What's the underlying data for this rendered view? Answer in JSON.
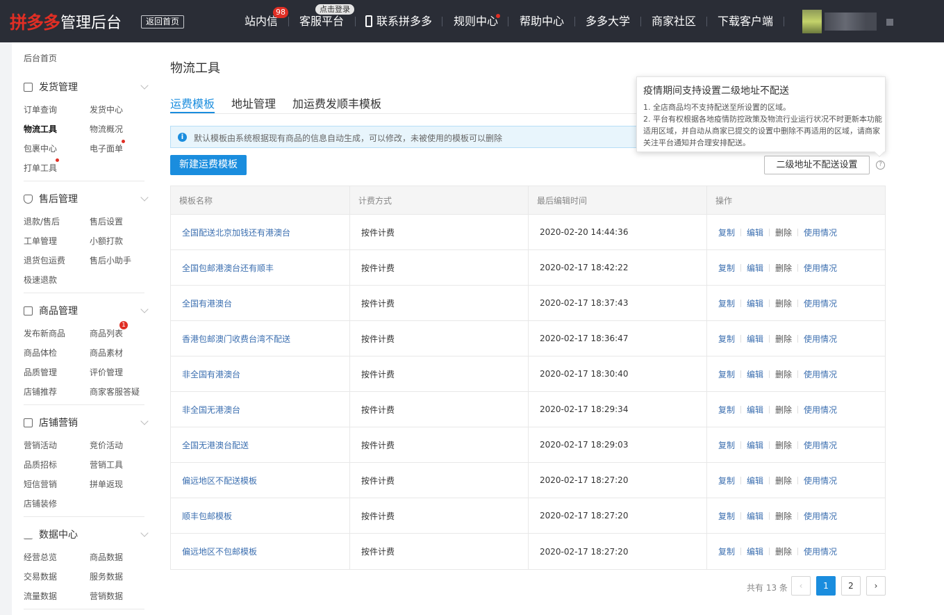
{
  "topbar": {
    "brand": "拼多多",
    "title": "管理后台",
    "back_home": "返回首页",
    "nav": {
      "messages": "站内信",
      "messages_badge": "98",
      "service": "客服平台",
      "service_tip": "点击登录",
      "contact": "联系拼多多",
      "rules": "规则中心",
      "help": "帮助中心",
      "university": "多多大学",
      "community": "商家社区",
      "download": "下载客户端"
    }
  },
  "sidebar": {
    "home": "后台首页",
    "sections": [
      {
        "title": "发货管理",
        "links": [
          "订单查询",
          "发货中心",
          "物流工具",
          "物流概况",
          "包裹中心",
          "电子面单",
          "打单工具"
        ]
      },
      {
        "title": "售后管理",
        "links": [
          "退款/售后",
          "售后设置",
          "工单管理",
          "小额打款",
          "退货包运费",
          "售后小助手",
          "极速退款"
        ]
      },
      {
        "title": "商品管理",
        "links": [
          "发布新商品",
          "商品列表",
          "商品体检",
          "商品素材",
          "品质管理",
          "评价管理",
          "店铺推荐",
          "商家客服答疑"
        ],
        "badge": "1"
      },
      {
        "title": "店铺营销",
        "links": [
          "营销活动",
          "竞价活动",
          "品质招标",
          "营销工具",
          "短信营销",
          "拼单返现",
          "店铺装修"
        ]
      },
      {
        "title": "数据中心",
        "links": [
          "经营总览",
          "商品数据",
          "交易数据",
          "服务数据",
          "流量数据",
          "营销数据"
        ]
      }
    ]
  },
  "main": {
    "title": "物流工具",
    "tabs": [
      "运费模板",
      "地址管理",
      "加运费发顺丰模板"
    ],
    "info": "默认模板由系统根据现有商品的信息自动生成，可以修改，未被使用的模板可以删除",
    "new_button": "新建运费模板",
    "second_level_button": "二级地址不配送设置",
    "tooltip": {
      "title": "疫情期间支持设置二级地址不配送",
      "line1": "1. 全店商品均不支持配送至所设置的区域。",
      "line2": "2. 平台有权根据各地疫情防控政策及物流行业运行状况不时更新本功能适用区域，并自动从商家已提交的设置中删除不再适用的区域，请商家关注平台通知并合理安排配送。"
    },
    "table": {
      "headers": [
        "模板名称",
        "计费方式",
        "最后编辑时间",
        "操作"
      ],
      "ops": [
        "复制",
        "编辑",
        "删除",
        "使用情况"
      ],
      "rows": [
        {
          "name": "全国配送北京加钱还有港澳台",
          "billing": "按件计费",
          "time": "2020-02-20 14:44:36"
        },
        {
          "name": "全国包邮港澳台还有顺丰",
          "billing": "按件计费",
          "time": "2020-02-17 18:42:22"
        },
        {
          "name": "全国有港澳台",
          "billing": "按件计费",
          "time": "2020-02-17 18:37:43"
        },
        {
          "name": "香港包邮澳门收费台湾不配送",
          "billing": "按件计费",
          "time": "2020-02-17 18:36:47"
        },
        {
          "name": "非全国有港澳台",
          "billing": "按件计费",
          "time": "2020-02-17 18:30:40"
        },
        {
          "name": "非全国无港澳台",
          "billing": "按件计费",
          "time": "2020-02-17 18:29:34"
        },
        {
          "name": "全国无港澳台配送",
          "billing": "按件计费",
          "time": "2020-02-17 18:29:03"
        },
        {
          "name": "偏远地区不配送模板",
          "billing": "按件计费",
          "time": "2020-02-17 18:27:20"
        },
        {
          "name": "顺丰包邮模板",
          "billing": "按件计费",
          "time": "2020-02-17 18:27:20"
        },
        {
          "name": "偏远地区不包邮模板",
          "billing": "按件计费",
          "time": "2020-02-17 18:27:20"
        }
      ]
    },
    "pagination": {
      "total": "共有 13 条",
      "pages": [
        "1",
        "2"
      ],
      "current": "1"
    }
  },
  "colors": {
    "topbar": "#2a2d36",
    "brand_red": "#e02e24",
    "accent_blue": "#1a8dde",
    "link_blue": "#3c6fb0"
  }
}
